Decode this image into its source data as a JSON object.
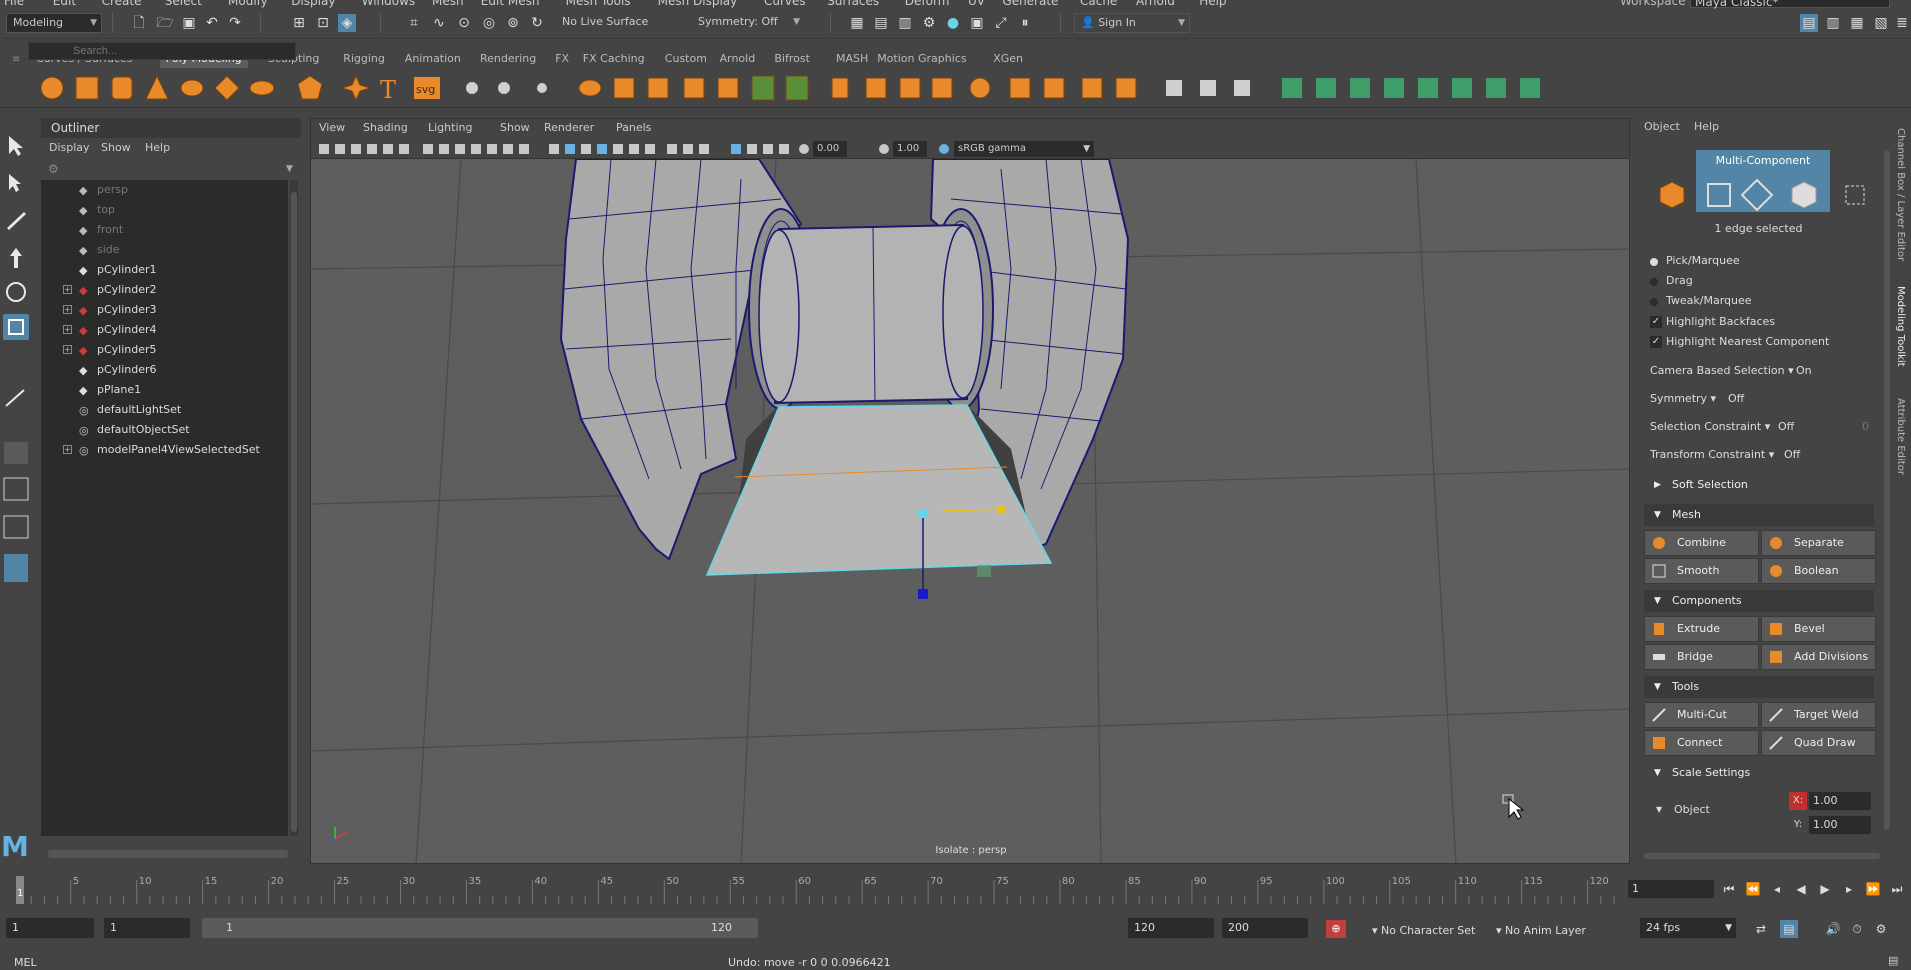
{
  "menubar": {
    "items": [
      "File",
      "Edit",
      "Create",
      "Select",
      "Modify",
      "Display",
      "Windows",
      "Mesh",
      "Edit Mesh",
      "Mesh Tools",
      "Mesh Display",
      "Curves",
      "Surfaces",
      "Deform",
      "UV",
      "Generate",
      "Cache",
      "Arnold",
      "Help"
    ],
    "workspace_label": "Workspace :",
    "workspace_value": "Maya Classic*"
  },
  "statusline": {
    "mode": "Modeling",
    "live_surface": "No Live Surface",
    "symmetry": "Symmetry: Off",
    "sign_in": "Sign In"
  },
  "shelf": {
    "tabs": [
      "Curves / Surfaces",
      "Poly Modeling",
      "Sculpting",
      "Rigging",
      "Animation",
      "Rendering",
      "FX",
      "FX Caching",
      "Custom",
      "Arnold",
      "Bifrost",
      "MASH",
      "Motion Graphics",
      "XGen"
    ],
    "active_tab": "Poly Modeling",
    "text_icon_t": "T",
    "text_icon_svg": "svg"
  },
  "outliner": {
    "title": "Outliner",
    "menu": [
      "Display",
      "Show",
      "Help"
    ],
    "search_placeholder": "Search...",
    "items": [
      {
        "label": "persp",
        "dim": true,
        "expand": false,
        "icon": "camera-icon"
      },
      {
        "label": "top",
        "dim": true,
        "expand": false,
        "icon": "camera-icon"
      },
      {
        "label": "front",
        "dim": true,
        "expand": false,
        "icon": "camera-icon"
      },
      {
        "label": "side",
        "dim": true,
        "expand": false,
        "icon": "camera-icon"
      },
      {
        "label": "pCylinder1",
        "dim": false,
        "expand": false,
        "icon": "transform-icon"
      },
      {
        "label": "pCylinder2",
        "dim": false,
        "expand": true,
        "icon": "mesh-icon"
      },
      {
        "label": "pCylinder3",
        "dim": false,
        "expand": true,
        "icon": "mesh-icon"
      },
      {
        "label": "pCylinder4",
        "dim": false,
        "expand": true,
        "icon": "mesh-icon"
      },
      {
        "label": "pCylinder5",
        "dim": false,
        "expand": true,
        "icon": "mesh-icon"
      },
      {
        "label": "pCylinder6",
        "dim": false,
        "expand": false,
        "icon": "transform-icon"
      },
      {
        "label": "pPlane1",
        "dim": false,
        "expand": false,
        "icon": "transform-icon"
      },
      {
        "label": "defaultLightSet",
        "dim": false,
        "expand": false,
        "icon": "set-icon"
      },
      {
        "label": "defaultObjectSet",
        "dim": false,
        "expand": false,
        "icon": "set-icon"
      },
      {
        "label": "modelPanel4ViewSelectedSet",
        "dim": false,
        "expand": true,
        "icon": "set-icon"
      }
    ]
  },
  "viewport": {
    "menu": [
      "View",
      "Shading",
      "Lighting",
      "Show",
      "Renderer",
      "Panels"
    ],
    "exposure": "0.00",
    "gamma": "1.00",
    "color_space": "sRGB gamma",
    "caption": "Isolate : persp"
  },
  "rightpanel": {
    "menu": [
      "Object",
      "Help"
    ],
    "mode_title": "Multi-Component",
    "selection_info": "1 edge selected",
    "pick_modes": [
      {
        "label": "Pick/Marquee",
        "on": true
      },
      {
        "label": "Drag",
        "on": false
      },
      {
        "label": "Tweak/Marquee",
        "on": false
      }
    ],
    "checkboxes": [
      {
        "label": "Highlight Backfaces",
        "checked": true
      },
      {
        "label": "Highlight Nearest Component",
        "checked": true
      }
    ],
    "options": [
      {
        "label": "Camera Based Selection",
        "value": "On"
      },
      {
        "label": "Symmetry",
        "value": "Off"
      },
      {
        "label": "Selection Constraint",
        "value": "Off",
        "extra": "0"
      },
      {
        "label": "Transform Constraint",
        "value": "Off"
      }
    ],
    "soft_selection": "Soft Selection",
    "mesh_section": "Mesh",
    "mesh_buttons": [
      "Combine",
      "Separate",
      "Smooth",
      "Boolean"
    ],
    "components_section": "Components",
    "components_buttons": [
      "Extrude",
      "Bevel",
      "Bridge",
      "Add Divisions"
    ],
    "tools_section": "Tools",
    "tools_buttons": [
      "Multi-Cut",
      "Target Weld",
      "Connect",
      "Quad Draw"
    ],
    "scale_section": "Scale Settings",
    "scale_space": "Object",
    "scale_x_label": "X:",
    "scale_x": "1.00",
    "scale_y_label": "Y:",
    "scale_y": "1.00",
    "side_tabs": [
      "Channel Box / Layer Editor",
      "Modeling Toolkit",
      "Attribute Editor"
    ]
  },
  "timeline": {
    "ticks": [
      "5",
      "10",
      "15",
      "20",
      "25",
      "30",
      "35",
      "40",
      "45",
      "50",
      "55",
      "60",
      "65",
      "70",
      "75",
      "80",
      "85",
      "90",
      "95",
      "100",
      "105",
      "110",
      "115",
      "120"
    ],
    "current_frame_marker": "1",
    "current_frame": "1"
  },
  "range": {
    "start": "1",
    "anim_start": "1",
    "slider_start": "1",
    "slider_end": "120",
    "end": "120",
    "anim_end": "200",
    "character_set": "No Character Set",
    "anim_layer": "No Anim Layer",
    "fps": "24 fps"
  },
  "cmdline": {
    "label": "MEL",
    "result": "Undo: move -r 0 0 0.0966421"
  },
  "colors": {
    "accent": "#5285a6",
    "shelf_orange": "#e8892a",
    "wire": "#1a1a6e",
    "selection_cyan": "#67d6e8"
  }
}
